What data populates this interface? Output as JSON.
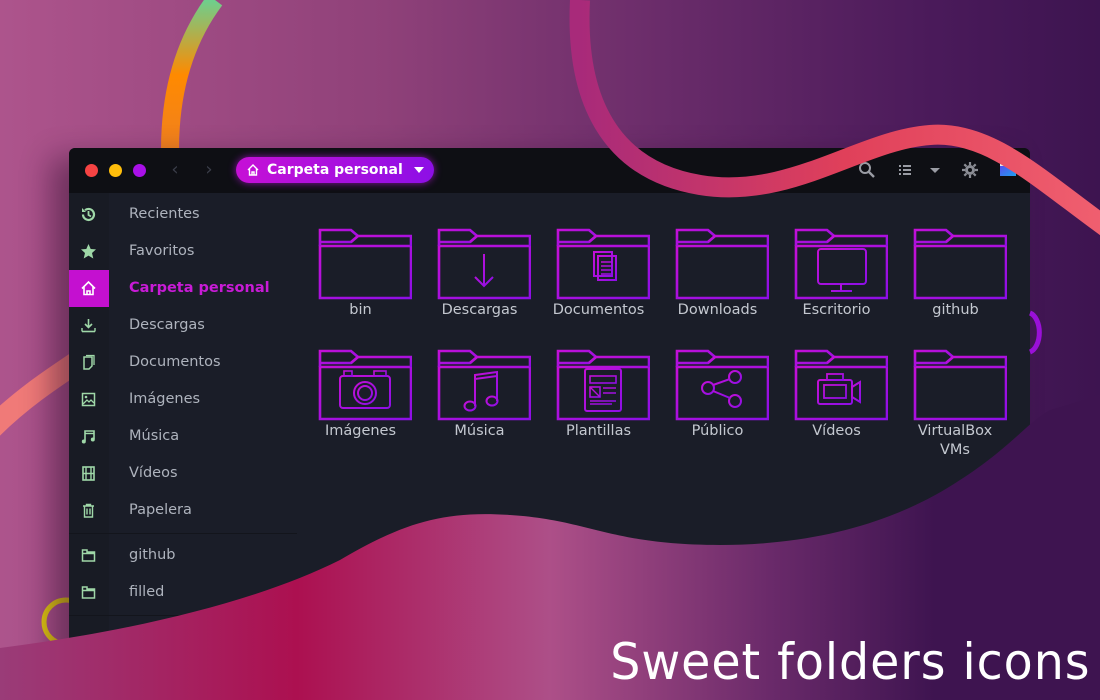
{
  "window": {
    "path_label": "Carpeta personal",
    "toolbar_icons": [
      "search-icon",
      "list-view-icon",
      "view-options-icon",
      "settings-icon",
      "folder-icon"
    ]
  },
  "colors": {
    "accent": "#c410d0",
    "accent_gradient_end": "#8d0fe6",
    "sidebar_icon": "#9fd8a8",
    "folder_stroke_start": "#c410d6",
    "folder_stroke_end": "#8d0fe6",
    "window_bg": "#1a1d28",
    "titlebar_bg": "#0e0f14"
  },
  "sidebar": {
    "items": [
      {
        "label": "Recientes",
        "icon": "history-icon"
      },
      {
        "label": "Favoritos",
        "icon": "star-icon"
      },
      {
        "label": "Carpeta personal",
        "icon": "home-icon",
        "active": true
      },
      {
        "label": "Descargas",
        "icon": "download-icon"
      },
      {
        "label": "Documentos",
        "icon": "document-icon"
      },
      {
        "label": "Imágenes",
        "icon": "image-icon"
      },
      {
        "label": "Música",
        "icon": "music-icon"
      },
      {
        "label": "Vídeos",
        "icon": "film-icon"
      },
      {
        "label": "Papelera",
        "icon": "trash-icon"
      }
    ],
    "bookmarks": [
      {
        "label": "github",
        "icon": "folder-icon"
      },
      {
        "label": "filled",
        "icon": "folder-icon"
      }
    ]
  },
  "folders": [
    {
      "label": "bin",
      "emblem": "none"
    },
    {
      "label": "Descargas",
      "emblem": "download-arrow"
    },
    {
      "label": "Documentos",
      "emblem": "document"
    },
    {
      "label": "Downloads",
      "emblem": "none"
    },
    {
      "label": "Escritorio",
      "emblem": "monitor"
    },
    {
      "label": "github",
      "emblem": "none"
    },
    {
      "label": "Imágenes",
      "emblem": "camera"
    },
    {
      "label": "Música",
      "emblem": "music-note"
    },
    {
      "label": "Plantillas",
      "emblem": "template"
    },
    {
      "label": "Público",
      "emblem": "share"
    },
    {
      "label": "Vídeos",
      "emblem": "video-camera"
    },
    {
      "label": "VirtualBox VMs",
      "emblem": "none"
    }
  ],
  "banner": {
    "title": "Sweet folders icons"
  }
}
